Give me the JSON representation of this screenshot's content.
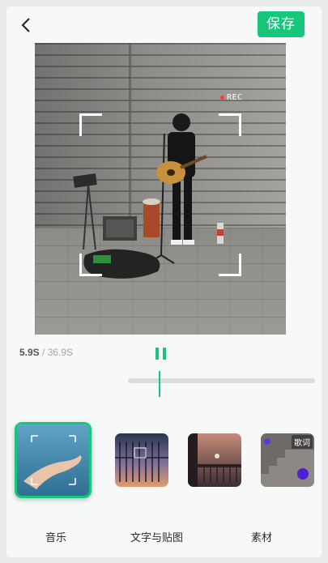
{
  "header": {
    "back_icon": "chevron-left-icon",
    "save_label": "保存"
  },
  "preview": {
    "rec_label": "REC"
  },
  "playback": {
    "current_time": "5.9S",
    "separator": " / ",
    "total_time": "36.9S",
    "progress": 0.16,
    "state": "playing"
  },
  "thumbnails": [
    {
      "id": "music",
      "selected": true,
      "badge": ""
    },
    {
      "id": "text-sticker",
      "selected": false,
      "badge": ""
    },
    {
      "id": "material",
      "selected": false,
      "badge": ""
    },
    {
      "id": "lyrics",
      "selected": false,
      "badge": "歌词"
    }
  ],
  "tabs": [
    {
      "label": "音乐"
    },
    {
      "label": "文字与贴图"
    },
    {
      "label": "素材"
    }
  ],
  "colors": {
    "accent": "#16c67a",
    "background": "#f7f8f8"
  }
}
